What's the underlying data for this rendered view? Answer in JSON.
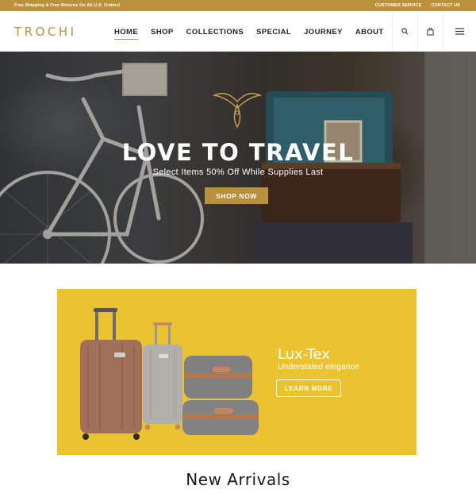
{
  "topbar": {
    "promo": "Free Shipping & Free Returns On All U.S. Orders!",
    "links": [
      "CUSTOMER SERVICE",
      "CONTACT US"
    ]
  },
  "header": {
    "logo": "TROCHI",
    "nav": [
      {
        "label": "HOME",
        "active": true
      },
      {
        "label": "SHOP",
        "active": false
      },
      {
        "label": "COLLECTIONS",
        "active": false
      },
      {
        "label": "SPECIAL",
        "active": false
      },
      {
        "label": "JOURNEY",
        "active": false
      },
      {
        "label": "ABOUT",
        "active": false
      }
    ],
    "icons": [
      "search-icon",
      "shopping-bag-icon",
      "hamburger-menu-icon"
    ]
  },
  "hero": {
    "title": "LOVE TO TRAVEL",
    "subtitle": "Select Items 50% Off While Supplies Last",
    "cta": "SHOP NOW"
  },
  "banner": {
    "title": "Lux-Tex",
    "subtitle": "Understated elegance",
    "cta": "LEARN MORE"
  },
  "section": {
    "title": "New Arrivals"
  },
  "colors": {
    "accent": "#b9913d",
    "banner_bg": "#ebc22f"
  }
}
